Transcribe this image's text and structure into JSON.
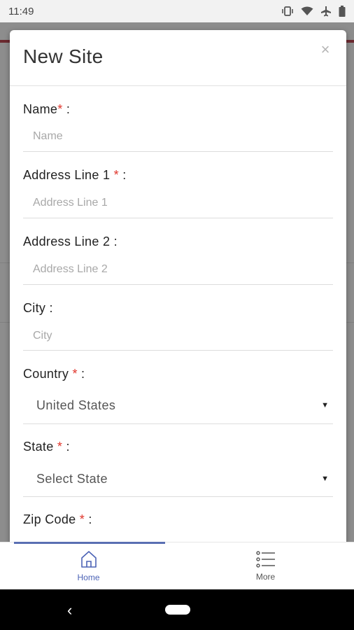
{
  "status_bar": {
    "time": "11:49"
  },
  "modal": {
    "title": "New Site",
    "close_label": "×",
    "fields": [
      {
        "label": "Name",
        "required_mark": "*",
        "suffix": " :",
        "placeholder": "Name"
      },
      {
        "label": "Address Line 1 ",
        "required_mark": "*",
        "suffix": " :",
        "placeholder": "Address Line 1"
      },
      {
        "label": "Address Line 2 :",
        "placeholder": "Address Line 2"
      },
      {
        "label": "City :",
        "placeholder": "City"
      },
      {
        "label": "Country ",
        "required_mark": "*",
        "suffix": " :",
        "value": "United States"
      },
      {
        "label": "State ",
        "required_mark": "*",
        "suffix": " :",
        "value": "Select State"
      },
      {
        "label": "Zip Code ",
        "required_mark": "*",
        "suffix": " :"
      }
    ]
  },
  "bottom_nav": [
    {
      "label": "Home",
      "icon": "home-icon",
      "active": true
    },
    {
      "label": "More",
      "icon": "list-icon",
      "active": false
    }
  ],
  "colors": {
    "accent": "#4c63b6",
    "required": "#e0352b"
  }
}
